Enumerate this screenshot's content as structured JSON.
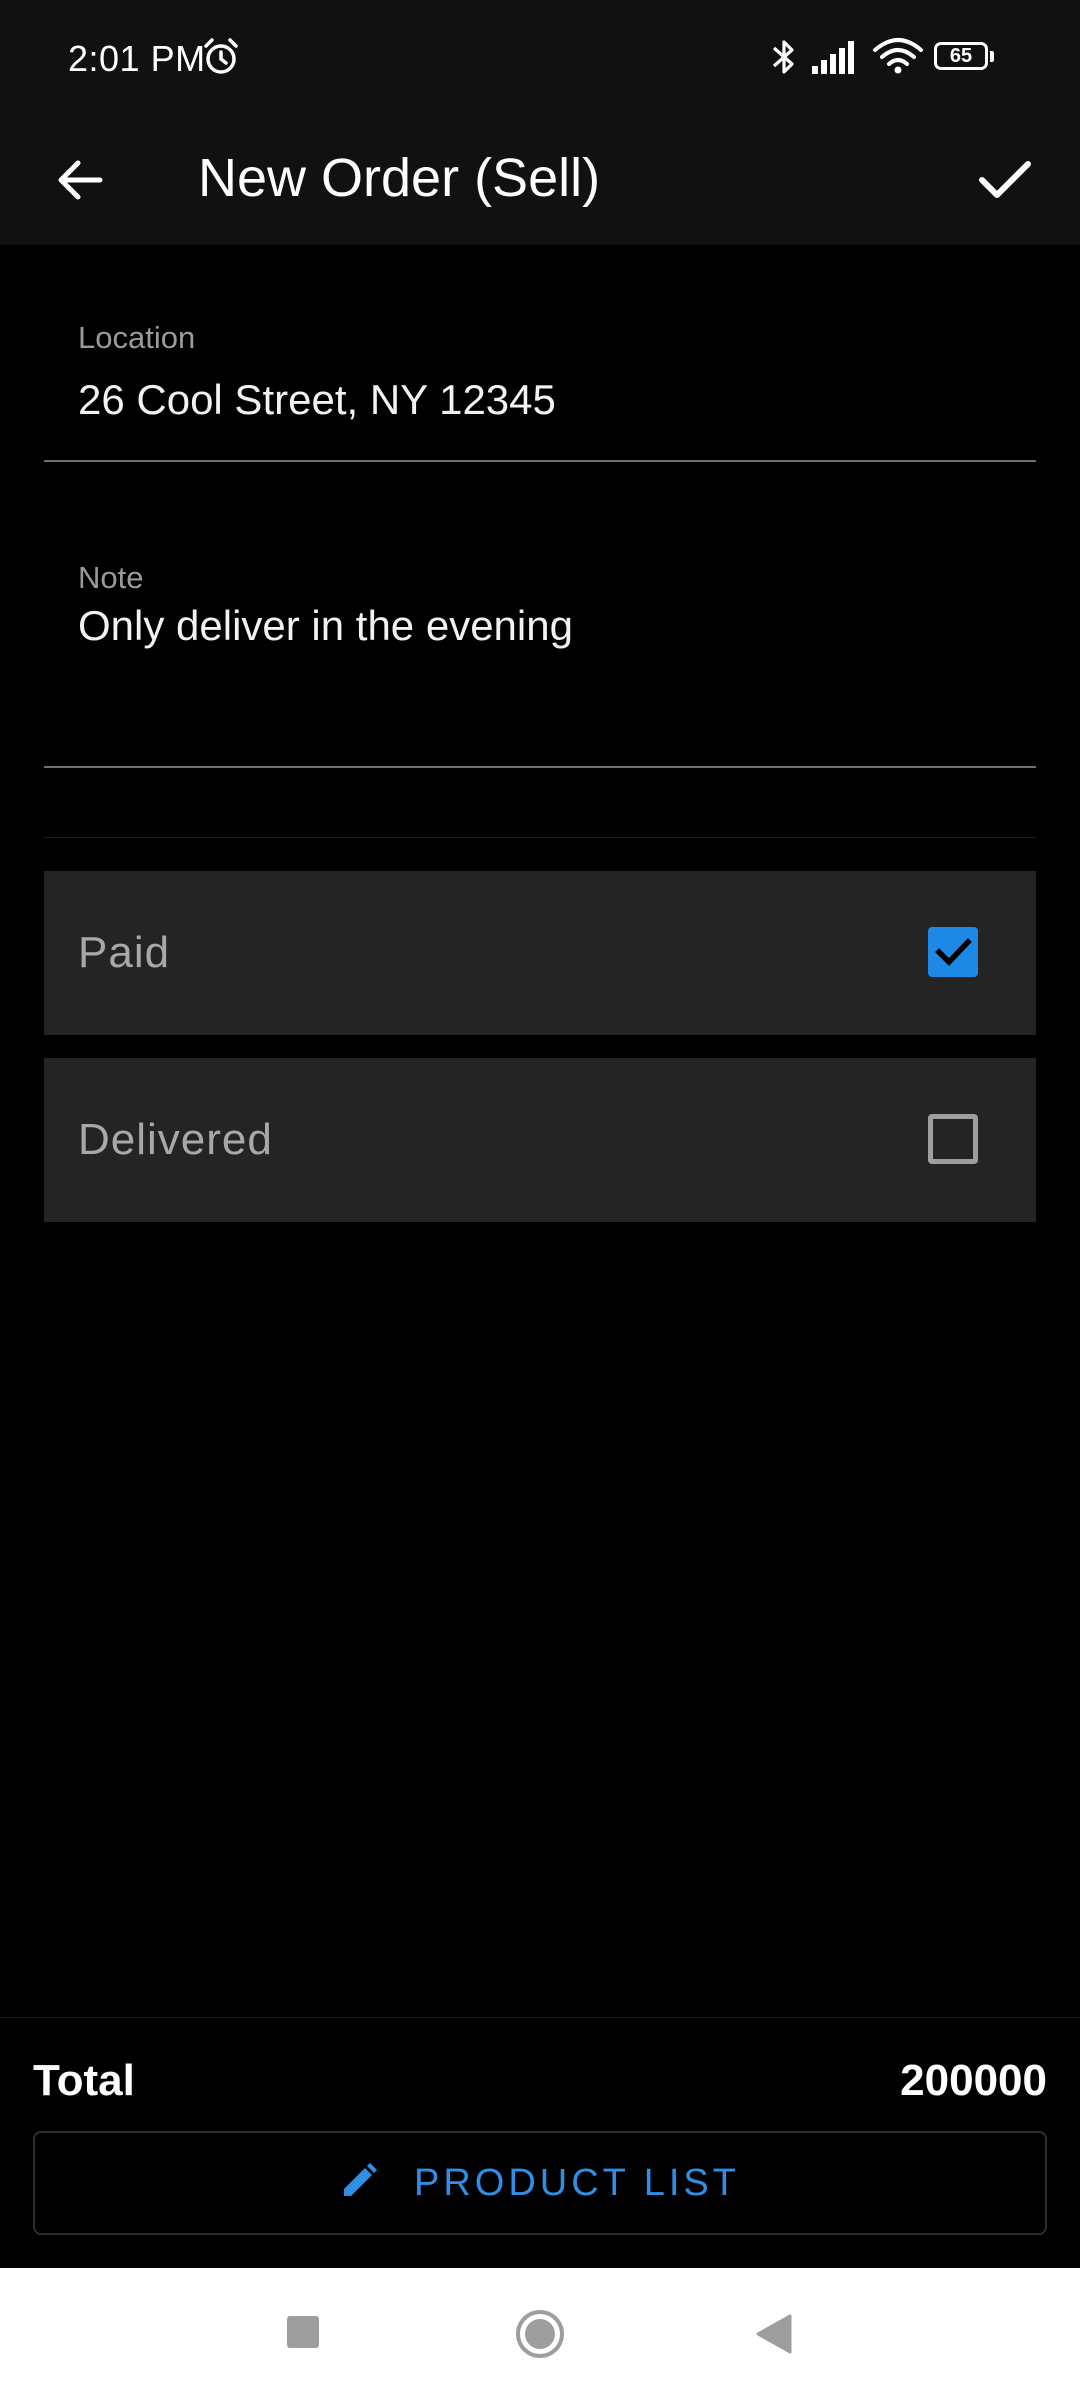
{
  "status_bar": {
    "time": "2:01 PM",
    "battery_level": "65",
    "icons": [
      "alarm-icon",
      "bluetooth-icon",
      "signal-icon",
      "wifi-icon",
      "battery-icon"
    ]
  },
  "app_bar": {
    "title": "New Order (Sell)",
    "back_icon": "arrow-back-icon",
    "confirm_icon": "check-icon"
  },
  "form": {
    "location": {
      "label": "Location",
      "value": "26 Cool Street, NY 12345"
    },
    "note": {
      "label": "Note",
      "value": "Only deliver in the evening"
    },
    "paid": {
      "label": "Paid",
      "checked": true
    },
    "delivered": {
      "label": "Delivered",
      "checked": false
    }
  },
  "summary": {
    "total_label": "Total",
    "total_value": "200000"
  },
  "actions": {
    "product_list_label": "PRODUCT LIST",
    "product_list_icon": "pencil-icon"
  },
  "colors": {
    "accent": "#1e88e5",
    "background": "#000000",
    "app_bar": "#111111",
    "row_background": "#242424"
  }
}
